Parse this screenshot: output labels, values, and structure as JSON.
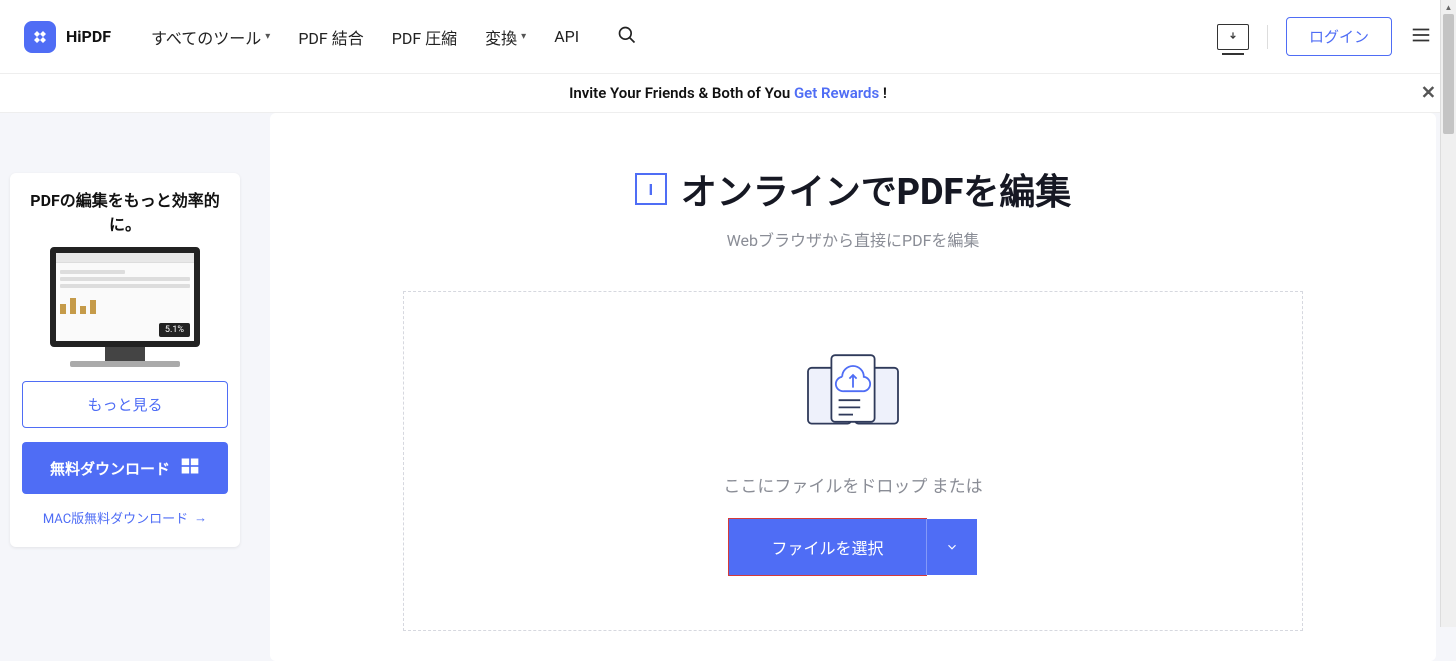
{
  "header": {
    "logo_text": "HiPDF",
    "nav": {
      "all_tools": "すべてのツール",
      "merge": "PDF 結合",
      "compress": "PDF 圧縮",
      "convert": "変換",
      "api": "API"
    },
    "login": "ログイン"
  },
  "banner": {
    "prefix": "Invite Your Friends & Both of You ",
    "link": "Get Rewards",
    "suffix": " !"
  },
  "sidebar": {
    "title": "PDFの編集をもっと効率的に。",
    "monitor_badge": "5.1%",
    "see_more": "もっと見る",
    "free_download": "無料ダウンロード",
    "mac_link": "MAC版無料ダウンロード"
  },
  "main": {
    "edit_icon_text": "I",
    "title": "オンラインでPDFを編集",
    "subtitle": "Webブラウザから直接にPDFを編集",
    "drop_text": "ここにファイルをドロップ または",
    "file_button": "ファイルを選択"
  }
}
